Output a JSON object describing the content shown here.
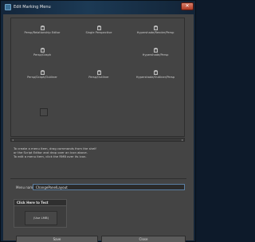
{
  "window": {
    "title": "Edit Marking Menu",
    "close_glyph": "✕"
  },
  "menu_items": [
    {
      "label": "Persp/Relationship Editor",
      "icon": "layout-icon"
    },
    {
      "label": "Single Perspective",
      "icon": "layout-icon"
    },
    {
      "label": "Hypershade/Render/Persp",
      "icon": "layout-icon"
    },
    {
      "label": "Persp/Graph",
      "icon": "layout-icon"
    },
    {
      "label": "Hypershade/Persp",
      "icon": "layout-icon"
    },
    {
      "label": "Persp/Graph/Outliner",
      "icon": "layout-icon"
    },
    {
      "label": "Persp/Outliner",
      "icon": "layout-icon"
    },
    {
      "label": "Hypershade/Outliner/Persp",
      "icon": "layout-icon"
    }
  ],
  "instructions": [
    "To create a menu item, drag commands from the shelf",
    "or the Script Editor and drop over an icon above.",
    "To edit a menu item, click the RMB over its icon."
  ],
  "menu_name": {
    "label": "Menu name:",
    "value": "ChangePanelLayout"
  },
  "test_area": {
    "header": "Click Here to Test",
    "body": "(Use LMB)"
  },
  "buttons": {
    "save": "Save",
    "close": "Close"
  },
  "colors": {
    "panel": "#444444",
    "input_border": "#5b7fa3",
    "title_bar": "#1c3a55"
  }
}
